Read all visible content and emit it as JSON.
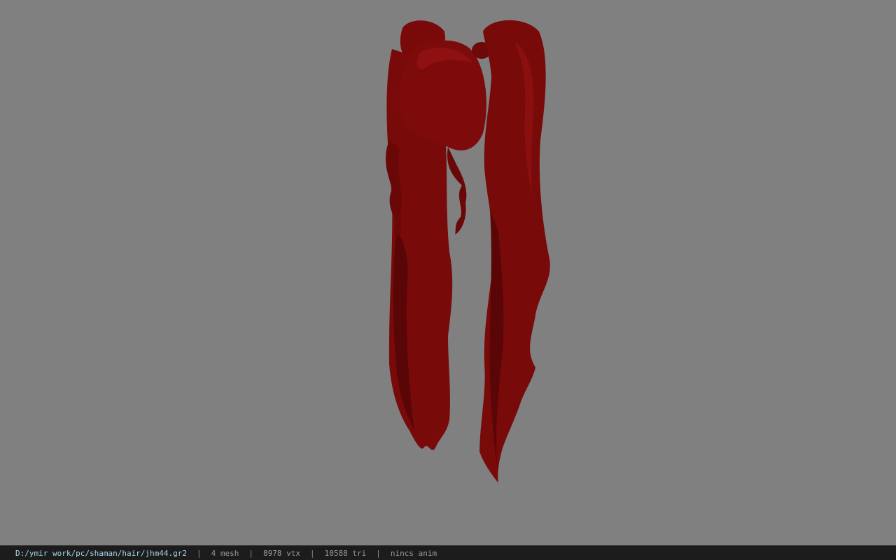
{
  "viewport": {
    "background_color": "#808080",
    "model_color": "#7a0a0a",
    "model_shadow_color": "#5a0606",
    "model_highlight_color": "#8e1010"
  },
  "statusbar": {
    "file_path": "D:/ymir work/pc/shaman/hair/jhm44.gr2",
    "separator": "|",
    "mesh_count": "4 mesh",
    "vertex_count": "8978 vtx",
    "triangle_count": "10588 tri",
    "anim_status": "nincs anim"
  }
}
